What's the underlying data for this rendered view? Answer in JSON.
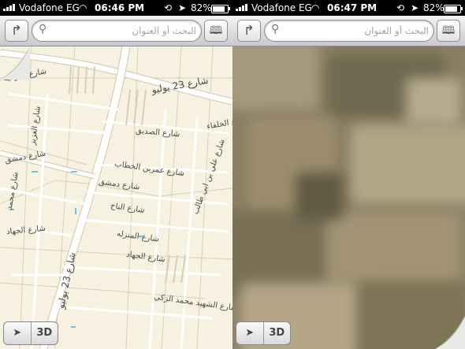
{
  "screens": [
    {
      "status": {
        "carrier": "Vodafone EG",
        "time": "06:46 PM",
        "battery": "82%",
        "battery_level": 0.82
      },
      "search": {
        "placeholder": "البحث أو العنوان"
      },
      "view": "map",
      "streets": [
        "شارع القوميه",
        "شارع 23 يوليو",
        "شارع العزيز",
        "شارع الصديق",
        "شارع دمشق",
        "شارع عمربن الخطاب",
        "شارع دمشق",
        "شارع محمد",
        "شارع الناخ",
        "شارع علي بن ابي طالب",
        "شارع الجهاد",
        "شارع المنزله",
        "شارع 23 يوليو",
        "شارع الجهاد",
        "شارع الشهيد محمد الزكي",
        "شارع الخلفاء"
      ],
      "controls": {
        "locate_icon": "location-arrow-icon",
        "three_d_label": "3D"
      }
    },
    {
      "status": {
        "carrier": "Vodafone EG",
        "time": "06:47 PM",
        "battery": "82%",
        "battery_level": 0.82
      },
      "search": {
        "placeholder": "البحث أو العنوان"
      },
      "view": "satellite",
      "controls": {
        "locate_icon": "location-arrow-icon",
        "three_d_label": "3D"
      }
    }
  ],
  "icons": {
    "directions": "directions-arrow-icon",
    "bookmarks": "bookmarks-book-icon",
    "search": "search-icon"
  },
  "colors": {
    "map_background": "#f6f1e0",
    "road": "#ffffff",
    "road_outline": "#d8cfb6",
    "satellite": "#8b7f63"
  }
}
